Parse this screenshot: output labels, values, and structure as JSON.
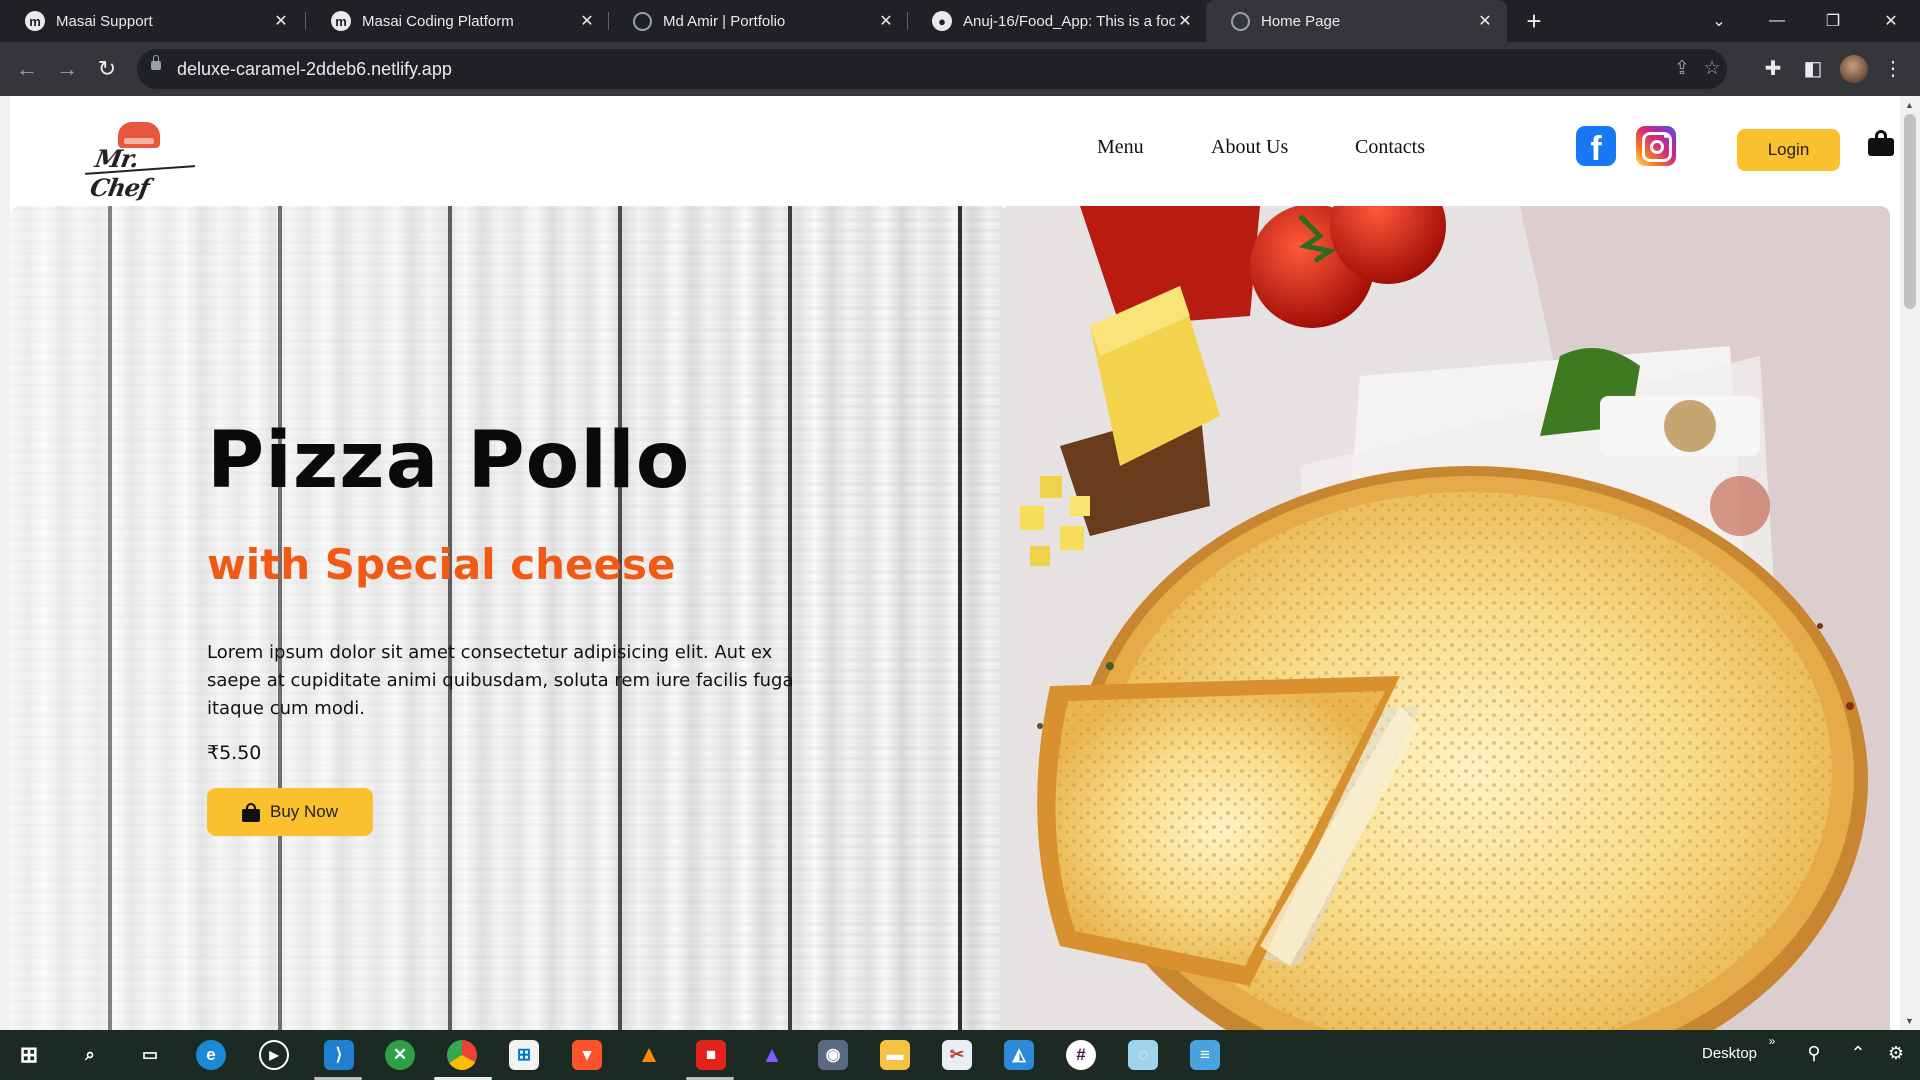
{
  "browser": {
    "tabs": [
      {
        "title": "Masai Support",
        "icon": "masai-icon",
        "active": false
      },
      {
        "title": "Masai Coding Platform",
        "icon": "masai-icon",
        "active": false
      },
      {
        "title": "Md Amir | Portfolio",
        "icon": "globe-icon",
        "active": false
      },
      {
        "title": "Anuj-16/Food_App: This is a foo",
        "icon": "github-icon",
        "active": false
      },
      {
        "title": "Home Page",
        "icon": "globe-icon",
        "active": true
      }
    ],
    "url": "deluxe-caramel-2ddeb6.netlify.app"
  },
  "site": {
    "logo_text": "Mr. Chef",
    "nav": [
      "Menu",
      "About Us",
      "Contacts"
    ],
    "login_label": "Login",
    "hero": {
      "title": "Pizza Pollo",
      "subtitle": "with Special cheese",
      "description": "Lorem ipsum dolor sit amet consectetur adipisicing elit. Aut ex saepe at cupiditate animi quibusdam, soluta rem iure facilis fuga itaque cum modi.",
      "price": "₹5.50",
      "buy_label": "Buy Now"
    },
    "colors": {
      "accent": "#fbc02d",
      "subtitle": "#f05a15"
    }
  },
  "taskbar": {
    "desktop_label": "Desktop",
    "apps": [
      "start-icon",
      "search-icon",
      "task-view-icon",
      "edge-icon",
      "media-player-icon",
      "vscode-icon",
      "xbox-icon",
      "chrome-icon",
      "store-icon",
      "brave-icon",
      "vlc-icon",
      "app-icon",
      "affinity-icon",
      "camera-icon",
      "file-explorer-icon",
      "snipping-tool-icon",
      "photos-icon",
      "slack-icon",
      "app-icon-2",
      "notepad-icon"
    ]
  }
}
